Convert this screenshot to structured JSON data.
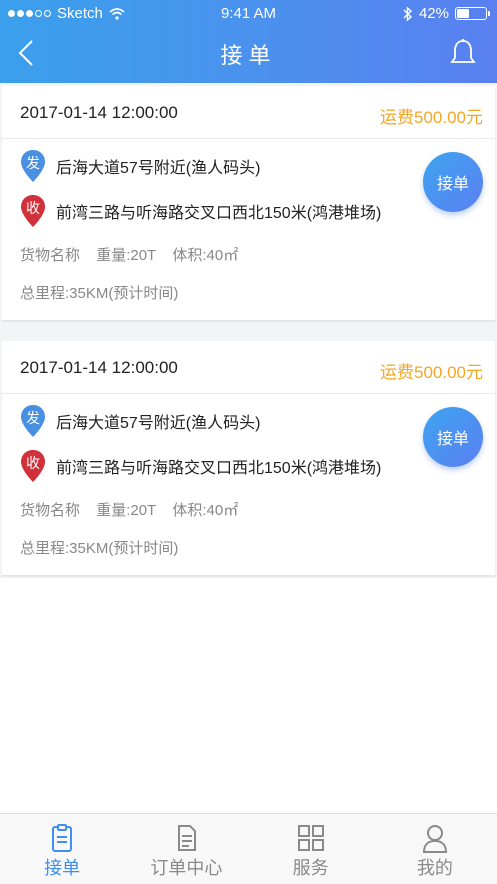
{
  "status_bar": {
    "carrier": "Sketch",
    "time": "9:41 AM",
    "battery": "42%"
  },
  "header": {
    "title": "接单"
  },
  "orders": [
    {
      "datetime": "2017-01-14 12:00:00",
      "fee": "运费500.00元",
      "from_badge": "发",
      "from_address": "后海大道57号附近(渔人码头)",
      "to_badge": "收",
      "to_address": "前湾三路与听海路交叉口西北150米(鸿港堆场)",
      "goods": "货物名称",
      "weight": "重量:20T",
      "volume": "体积:40㎡",
      "distance": "总里程:35KM(预计时间)",
      "button": "接单"
    },
    {
      "datetime": "2017-01-14 12:00:00",
      "fee": "运费500.00元",
      "from_badge": "发",
      "from_address": "后海大道57号附近(渔人码头)",
      "to_badge": "收",
      "to_address": "前湾三路与听海路交叉口西北150米(鸿港堆场)",
      "goods": "货物名称",
      "weight": "重量:20T",
      "volume": "体积:40㎡",
      "distance": "总里程:35KM(预计时间)",
      "button": "接单"
    }
  ],
  "tabbar": {
    "items": [
      {
        "label": "接单",
        "icon": "clipboard-icon",
        "active": true
      },
      {
        "label": "订单中心",
        "icon": "document-icon",
        "active": false
      },
      {
        "label": "服务",
        "icon": "grid-icon",
        "active": false
      },
      {
        "label": "我的",
        "icon": "user-icon",
        "active": false
      }
    ]
  },
  "colors": {
    "accent": "#3f8ff0",
    "fee": "#f5a623",
    "from_pin": "#4a90e2",
    "to_pin": "#d0313a"
  }
}
